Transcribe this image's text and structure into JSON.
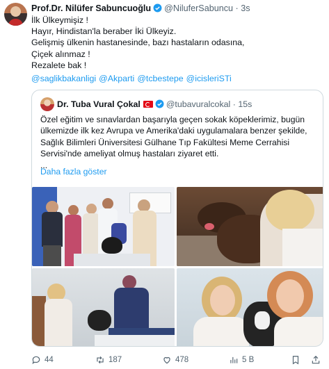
{
  "tweet": {
    "author_name": "Prof.Dr. Nilüfer Sabuncuoğlu",
    "author_handle": "@NiluferSabuncu",
    "separator": "·",
    "time": "3s",
    "lines": [
      "İlk Ülkeymişiz !",
      "Hayır, Hindistan'la beraber İki Ülkeyiz.",
      "Gelişmiş ülkenin hastanesinde, bazı hastaların odasına,",
      "Çiçek alınmaz !",
      "Rezalete bak !"
    ],
    "mentions": [
      "@saglikbakanligi",
      "@Akparti",
      "@tcbestepe",
      "@icisleriSTi"
    ]
  },
  "quote": {
    "author_name": "Dr. Tuba Vural Çokal",
    "author_handle": "@tubavuralcokal",
    "separator": "·",
    "time": "15s",
    "lines": [
      "Özel eğitim ve sınavlardan başarıyla geçen sokak köpeklerimiz, bugün",
      "ülkemizde ilk kez Avrupa ve Amerika'daki uygulamalara benzer şekilde,",
      "Sağlık Bilimleri Üniversitesi Gülhane Tıp Fakültesi Meme Cerrahisi",
      "Servisi'nde ameliyat olmuş hastaları ziyaret etti.",
      "..."
    ],
    "show_more": "Daha fazla göster",
    "photos": [
      "group-photo",
      "dog-closeup-photo",
      "patient-bed-photo",
      "selfie-photo"
    ]
  },
  "actions": {
    "replies": "44",
    "retweets": "187",
    "likes": "478",
    "views": "5 B"
  },
  "colors": {
    "link": "#1d9bf0",
    "muted": "#536471",
    "border": "#cfd9de"
  }
}
